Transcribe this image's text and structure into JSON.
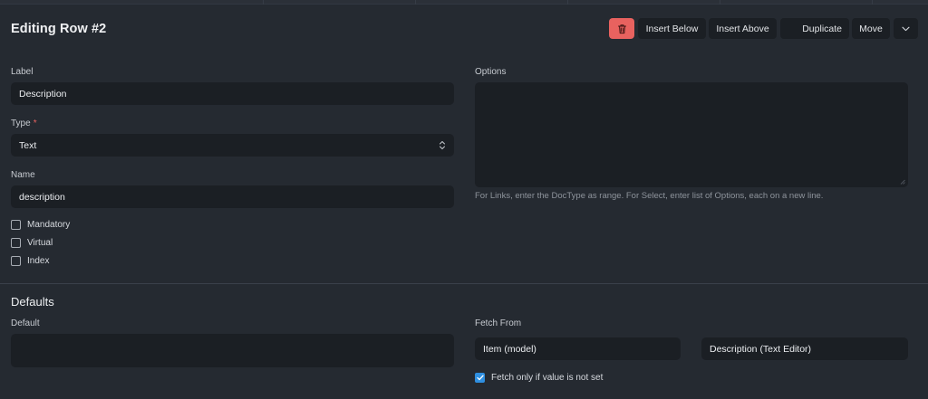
{
  "form": {
    "title": "Editing Row #2",
    "toolbar": {
      "delete_icon": "trash-icon",
      "insert_below": "Insert Below",
      "insert_above": "Insert Above",
      "duplicate": "Duplicate",
      "move": "Move",
      "more_icon": "chevron-down-icon"
    },
    "label_field": {
      "label": "Label",
      "value": "Description"
    },
    "type_field": {
      "label": "Type",
      "required_mark": "*",
      "value": "Text"
    },
    "name_field": {
      "label": "Name",
      "value": "description"
    },
    "checkboxes": [
      {
        "label": "Mandatory",
        "checked": false
      },
      {
        "label": "Virtual",
        "checked": false
      },
      {
        "label": "Index",
        "checked": false
      }
    ],
    "options_field": {
      "label": "Options",
      "value": "",
      "help": "For Links, enter the DocType as range. For Select, enter list of Options, each on a new line."
    }
  },
  "defaults": {
    "title": "Defaults",
    "default_field": {
      "label": "Default",
      "value": ""
    },
    "fetch_from": {
      "label": "Fetch From",
      "model_value": "Item (model)",
      "field_value": "Description (Text Editor)"
    },
    "fetch_if_empty": {
      "label": "Fetch only if value is not set",
      "checked": true
    }
  },
  "colors": {
    "background": "#252a31",
    "input": "#1b1f24",
    "danger": "#e8625f",
    "accent": "#2f8fe0"
  }
}
